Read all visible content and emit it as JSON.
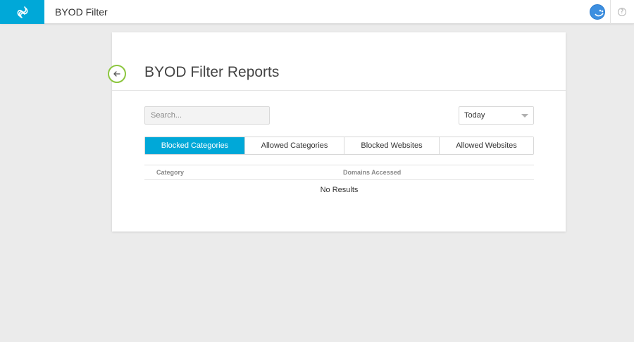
{
  "app": {
    "title": "BYOD Filter",
    "logo": "infinity-logo-icon",
    "brand_color": "#00a8d8"
  },
  "header": {
    "avatar": "user-avatar",
    "help_icon": "?"
  },
  "page": {
    "title": "BYOD Filter Reports",
    "back_icon": "arrow-left-icon",
    "accent_color": "#8cc63f"
  },
  "filters": {
    "search_placeholder": "Search...",
    "search_value": "",
    "date_range": {
      "selected": "Today"
    }
  },
  "tabs": [
    {
      "label": "Blocked Categories",
      "active": true
    },
    {
      "label": "Allowed Categories",
      "active": false
    },
    {
      "label": "Blocked Websites",
      "active": false
    },
    {
      "label": "Allowed Websites",
      "active": false
    }
  ],
  "table": {
    "columns": [
      "Category",
      "Domains Accessed"
    ],
    "rows": [],
    "empty_message": "No Results"
  }
}
